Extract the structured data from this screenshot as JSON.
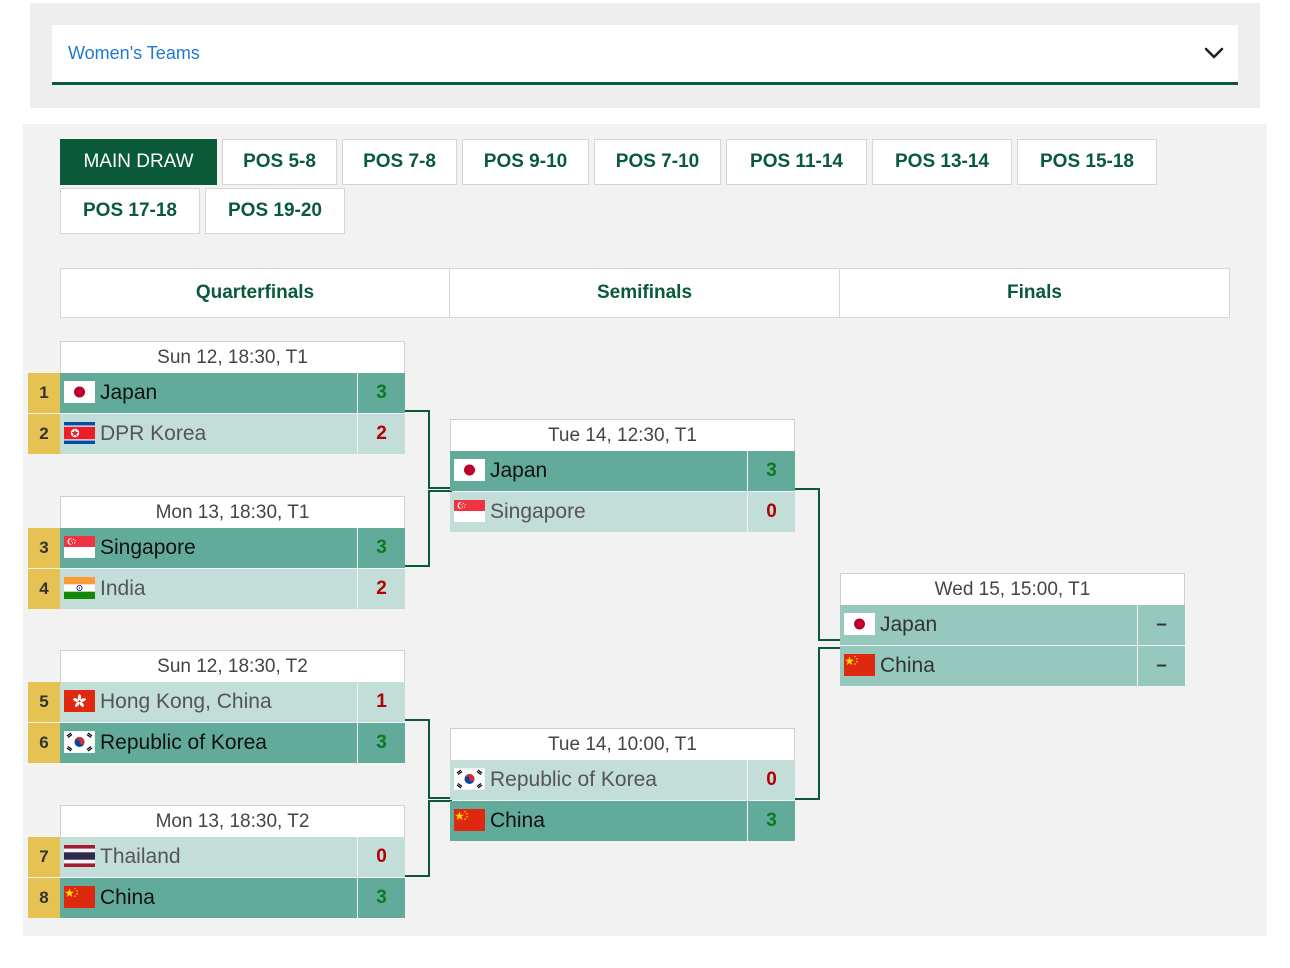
{
  "category_select": {
    "label": "Women's Teams"
  },
  "tabs": [
    {
      "label": "MAIN DRAW",
      "active": true
    },
    {
      "label": "POS 5-8"
    },
    {
      "label": "POS 7-8"
    },
    {
      "label": "POS 9-10"
    },
    {
      "label": "POS 7-10"
    },
    {
      "label": "POS 11-14"
    },
    {
      "label": "POS 13-14"
    },
    {
      "label": "POS 15-18"
    },
    {
      "label": "POS 17-18"
    },
    {
      "label": "POS 19-20"
    }
  ],
  "rounds": [
    "Quarterfinals",
    "Semifinals",
    "Finals"
  ],
  "matches": [
    {
      "id": "qf1",
      "time": "Sun 12, 18:30, T1",
      "teams": [
        {
          "seed": "1",
          "name": "Japan",
          "flag": "japan-flag",
          "score": "3",
          "result": "win"
        },
        {
          "seed": "2",
          "name": "DPR Korea",
          "flag": "dpr-korea-flag",
          "score": "2",
          "result": "lose"
        }
      ]
    },
    {
      "id": "qf2",
      "time": "Mon 13, 18:30, T1",
      "teams": [
        {
          "seed": "3",
          "name": "Singapore",
          "flag": "singapore-flag",
          "score": "3",
          "result": "win"
        },
        {
          "seed": "4",
          "name": "India",
          "flag": "india-flag",
          "score": "2",
          "result": "lose"
        }
      ]
    },
    {
      "id": "qf3",
      "time": "Sun 12, 18:30, T2",
      "teams": [
        {
          "seed": "5",
          "name": "Hong Kong, China",
          "flag": "hong-kong-flag",
          "score": "1",
          "result": "lose"
        },
        {
          "seed": "6",
          "name": "Republic of Korea",
          "flag": "korea-flag",
          "score": "3",
          "result": "win"
        }
      ]
    },
    {
      "id": "qf4",
      "time": "Mon 13, 18:30, T2",
      "teams": [
        {
          "seed": "7",
          "name": "Thailand",
          "flag": "thailand-flag",
          "score": "0",
          "result": "lose"
        },
        {
          "seed": "8",
          "name": "China",
          "flag": "china-flag",
          "score": "3",
          "result": "win"
        }
      ]
    },
    {
      "id": "sf1",
      "time": "Tue 14, 12:30, T1",
      "teams": [
        {
          "name": "Japan",
          "flag": "japan-flag",
          "score": "3",
          "result": "win"
        },
        {
          "name": "Singapore",
          "flag": "singapore-flag",
          "score": "0",
          "result": "lose"
        }
      ]
    },
    {
      "id": "sf2",
      "time": "Tue 14, 10:00, T1",
      "teams": [
        {
          "name": "Republic of Korea",
          "flag": "korea-flag",
          "score": "0",
          "result": "lose"
        },
        {
          "name": "China",
          "flag": "china-flag",
          "score": "3",
          "result": "win"
        }
      ]
    },
    {
      "id": "final",
      "time": "Wed 15, 15:00, T1",
      "teams": [
        {
          "name": "Japan",
          "flag": "japan-flag",
          "score": "–",
          "result": "pending"
        },
        {
          "name": "China",
          "flag": "china-flag",
          "score": "–",
          "result": "pending"
        }
      ]
    }
  ],
  "colors": {
    "brand_green": "#0a5a3a",
    "winner_row": "#62aa9a",
    "loser_row": "#c3ddd8",
    "pending_row": "#97c8bd",
    "seed_badge": "#e6c253",
    "score_win": "#0b7a20",
    "score_lose": "#b30000"
  }
}
